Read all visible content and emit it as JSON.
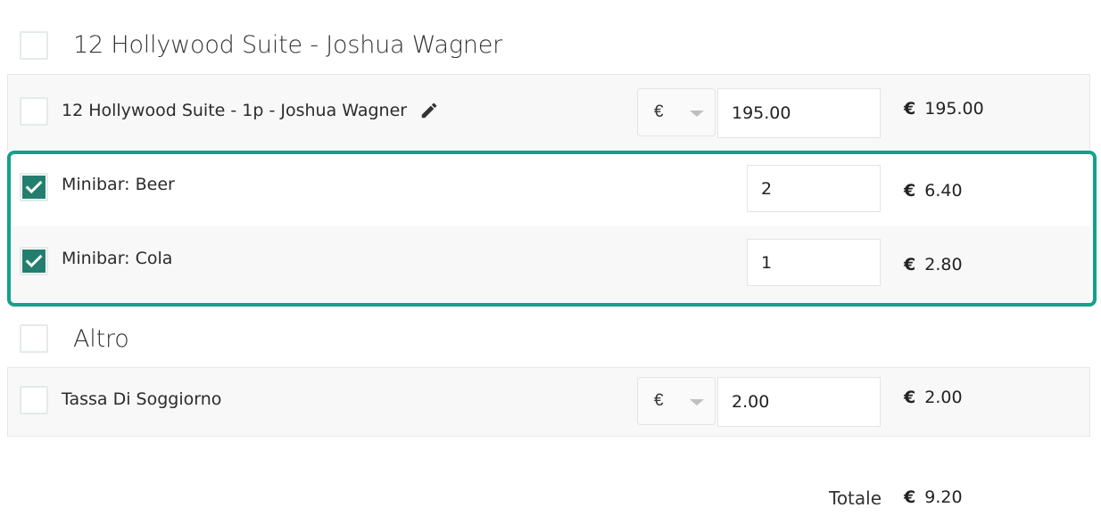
{
  "groups": [
    {
      "title": "12 Hollywood Suite - Joshua Wagner",
      "items": [
        {
          "label": "12 Hollywood Suite - 1p - Joshua Wagner",
          "currency": "€",
          "price": "195.00",
          "amount_currency": "€",
          "amount": "195.00",
          "checked": false
        },
        {
          "label": "Minibar: Beer",
          "quantity": "2",
          "amount_currency": "€",
          "amount": "6.40",
          "checked": true
        },
        {
          "label": "Minibar: Cola",
          "quantity": "1",
          "amount_currency": "€",
          "amount": "2.80",
          "checked": true
        }
      ]
    },
    {
      "title": "Altro",
      "items": [
        {
          "label": "Tassa Di Soggiorno",
          "currency": "€",
          "price": "2.00",
          "amount_currency": "€",
          "amount": "2.00",
          "checked": false
        }
      ]
    }
  ],
  "total": {
    "label": "Totale",
    "currency": "€",
    "amount": "9.20"
  },
  "colors": {
    "accent": "#247e6f",
    "highlight_border": "#15a08b"
  },
  "icons": {
    "edit": "pencil-icon",
    "checkmark": "checkmark-icon",
    "dropdown": "chevron-down-icon"
  }
}
